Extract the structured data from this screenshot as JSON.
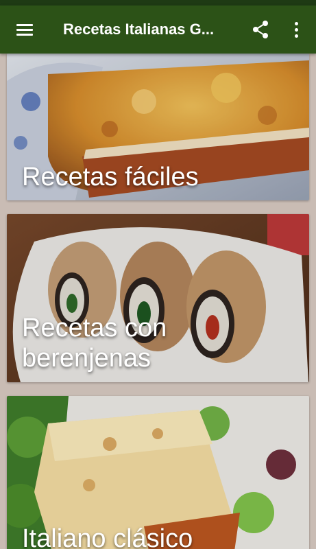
{
  "app_bar": {
    "title": "Recetas Italianas G...",
    "menu_icon": "hamburger-menu-icon",
    "share_icon": "share-icon",
    "more_icon": "more-vert-icon",
    "color": "#2c5217"
  },
  "cards": [
    {
      "label": "Recetas fáciles",
      "image": "lasagna-slice-photo"
    },
    {
      "label": "Recetas con berenjenas",
      "image": "eggplant-rolls-photo"
    },
    {
      "label": "Italiano clásico",
      "image": "lasagna-with-salad-photo"
    }
  ]
}
